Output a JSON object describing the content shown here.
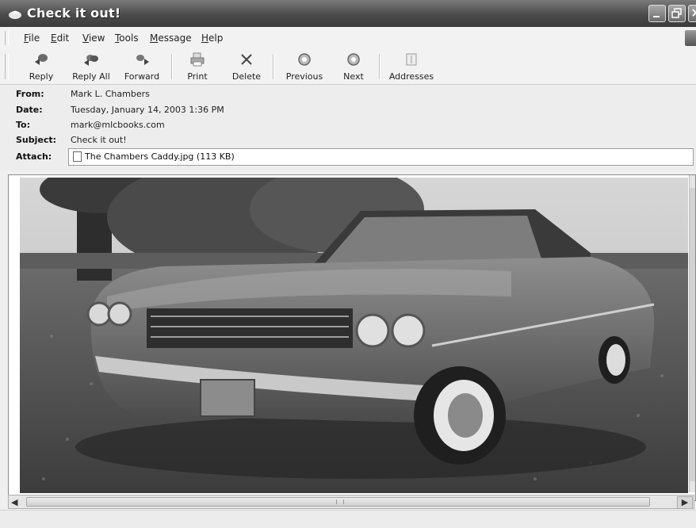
{
  "window": {
    "title": "Check it out!"
  },
  "menu": {
    "items": [
      {
        "label": "File",
        "accel": "F",
        "rest": "ile"
      },
      {
        "label": "Edit",
        "accel": "E",
        "rest": "dit"
      },
      {
        "label": "View",
        "accel": "V",
        "rest": "iew"
      },
      {
        "label": "Tools",
        "accel": "T",
        "rest": "ools"
      },
      {
        "label": "Message",
        "accel": "M",
        "rest": "essage"
      },
      {
        "label": "Help",
        "accel": "H",
        "rest": "elp"
      }
    ]
  },
  "toolbar": {
    "buttons": [
      {
        "label": "Reply",
        "icon": "reply-icon"
      },
      {
        "label": "Reply All",
        "icon": "reply-all-icon"
      },
      {
        "label": "Forward",
        "icon": "forward-icon"
      },
      {
        "label": "Print",
        "icon": "printer-icon"
      },
      {
        "label": "Delete",
        "icon": "delete-x-icon"
      },
      {
        "label": "Previous",
        "icon": "previous-icon"
      },
      {
        "label": "Next",
        "icon": "next-icon"
      },
      {
        "label": "Addresses",
        "icon": "address-book-icon"
      }
    ]
  },
  "message": {
    "from_label": "From:",
    "from": "Mark L. Chambers",
    "date_label": "Date:",
    "date": "Tuesday, January 14, 2003 1:36 PM",
    "to_label": "To:",
    "to": "mark@mlcbooks.com",
    "subject_label": "Subject:",
    "subject": "Check it out!",
    "attach_label": "Attach:",
    "attachment": "The Chambers Caddy.jpg (113 KB)"
  },
  "colors": {
    "titlebar": "#4b4b4b",
    "window_bg": "#efefef"
  }
}
